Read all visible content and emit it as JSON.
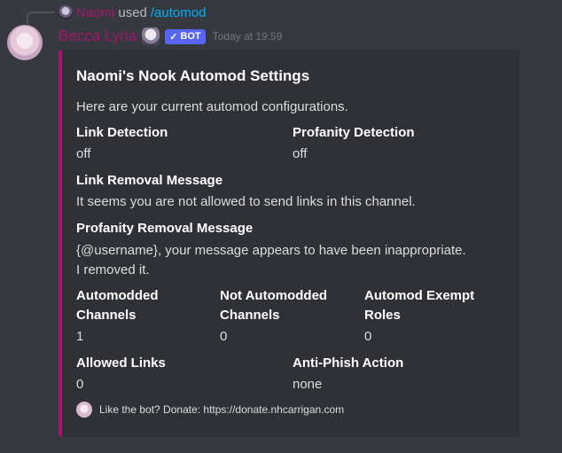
{
  "reply": {
    "name": "Naomi",
    "used_text": "used",
    "command": "/automod"
  },
  "message": {
    "author": "Becca Lyria",
    "bot_tag": "BOT",
    "timestamp": "Today at 19:59",
    "accent_color": "#a4156b"
  },
  "embed": {
    "title": "Naomi's Nook Automod Settings",
    "description": "Here are your current automod configurations.",
    "fields": [
      {
        "name": "Link Detection",
        "value": "off"
      },
      {
        "name": "Profanity Detection",
        "value": "off"
      },
      {
        "name": "Link Removal Message",
        "value": "It seems you are not allowed to send links in this channel."
      },
      {
        "name": "Profanity Removal Message",
        "value_line1": "{@username}, your message appears to have been inappropriate.",
        "value_line2": "I removed it."
      },
      {
        "name_line1": "Automodded",
        "name_line2": "Channels",
        "value": "1"
      },
      {
        "name_line1": "Not Automodded",
        "name_line2": "Channels",
        "value": "0"
      },
      {
        "name_line1": "Automod Exempt",
        "name_line2": "Roles",
        "value": "0"
      },
      {
        "name": "Allowed Links",
        "value": "0"
      },
      {
        "name": "Anti-Phish Action",
        "value": "none"
      }
    ],
    "footer": "Like the bot? Donate: https://donate.nhcarrigan.com"
  }
}
